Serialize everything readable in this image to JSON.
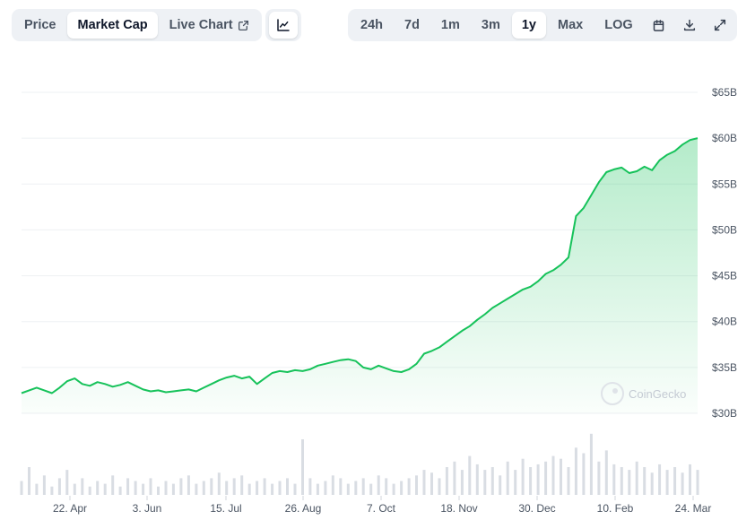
{
  "tabs": {
    "price": "Price",
    "market_cap": "Market Cap",
    "live_chart": "Live Chart"
  },
  "icons": {
    "external": "external-link-icon",
    "line_chart": "line-chart-icon",
    "calendar": "calendar-icon",
    "download": "download-icon",
    "expand": "expand-icon"
  },
  "ranges": [
    "24h",
    "7d",
    "1m",
    "3m",
    "1y",
    "Max",
    "LOG"
  ],
  "active_range": "1y",
  "watermark": "CoinGecko",
  "colors": {
    "line": "#16c25a",
    "grid": "#eef0f3",
    "volume": "#d9dde3"
  },
  "chart_data": {
    "type": "area",
    "y_ticks": [
      "$65B",
      "$60B",
      "$55B",
      "$50B",
      "$45B",
      "$40B",
      "$35B",
      "$30B"
    ],
    "y_tick_values": [
      65,
      60,
      55,
      50,
      45,
      40,
      35,
      30
    ],
    "x_ticks": [
      "22. Apr",
      "3. Jun",
      "15. Jul",
      "26. Aug",
      "7. Oct",
      "18. Nov",
      "30. Dec",
      "10. Feb",
      "24. Mar"
    ],
    "ylim": [
      30,
      65
    ],
    "y_unit": "billion USD",
    "series": [
      {
        "values": [
          32.2,
          32.5,
          32.8,
          32.5,
          32.2,
          32.8,
          33.5,
          33.8,
          33.2,
          33.0,
          33.4,
          33.2,
          32.9,
          33.1,
          33.4,
          33.0,
          32.6,
          32.4,
          32.5,
          32.3,
          32.4,
          32.5,
          32.6,
          32.4,
          32.8,
          33.2,
          33.6,
          33.9,
          34.1,
          33.8,
          34.0,
          33.2,
          33.8,
          34.4,
          34.6,
          34.5,
          34.7,
          34.6,
          34.8,
          35.2,
          35.4,
          35.6,
          35.8,
          35.9,
          35.7,
          35.0,
          34.8,
          35.2,
          34.9,
          34.6,
          34.5,
          34.8,
          35.4,
          36.5,
          36.8,
          37.2,
          37.8,
          38.4,
          39.0,
          39.5,
          40.2,
          40.8,
          41.5,
          42.0,
          42.5,
          43.0,
          43.5,
          43.8,
          44.4,
          45.2,
          45.6,
          46.2,
          47.0,
          51.5,
          52.4,
          53.8,
          55.2,
          56.3,
          56.6,
          56.8,
          56.2,
          56.4,
          56.9,
          56.5,
          57.6,
          58.2,
          58.6,
          59.3,
          59.8,
          60.0
        ],
        "volume": [
          0.25,
          0.5,
          0.2,
          0.35,
          0.15,
          0.3,
          0.45,
          0.2,
          0.3,
          0.15,
          0.25,
          0.2,
          0.35,
          0.15,
          0.3,
          0.25,
          0.2,
          0.3,
          0.15,
          0.25,
          0.2,
          0.3,
          0.35,
          0.2,
          0.25,
          0.3,
          0.4,
          0.25,
          0.3,
          0.35,
          0.2,
          0.25,
          0.3,
          0.2,
          0.25,
          0.3,
          0.2,
          1.0,
          0.3,
          0.2,
          0.25,
          0.35,
          0.3,
          0.2,
          0.25,
          0.3,
          0.2,
          0.35,
          0.3,
          0.2,
          0.25,
          0.3,
          0.35,
          0.45,
          0.4,
          0.3,
          0.5,
          0.6,
          0.45,
          0.7,
          0.55,
          0.45,
          0.5,
          0.35,
          0.6,
          0.45,
          0.65,
          0.5,
          0.55,
          0.6,
          0.7,
          0.65,
          0.5,
          0.85,
          0.75,
          1.1,
          0.6,
          0.8,
          0.55,
          0.5,
          0.45,
          0.6,
          0.5,
          0.4,
          0.55,
          0.45,
          0.5,
          0.4,
          0.55,
          0.45
        ]
      }
    ]
  }
}
